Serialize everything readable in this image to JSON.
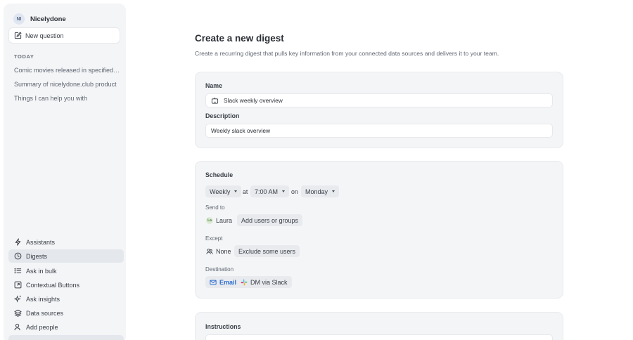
{
  "sidebar": {
    "workspace": {
      "avatar": "NI",
      "name": "Nicelydone"
    },
    "new_question": "New question",
    "section_today": "TODAY",
    "history": [
      "Comic movies released in specified d...",
      "Summary of nicelydone.club product",
      "Things I can help you with"
    ],
    "nav": [
      {
        "label": "Assistants",
        "icon": "bolt-icon"
      },
      {
        "label": "Digests",
        "icon": "clock-icon",
        "active": true
      },
      {
        "label": "Ask in bulk",
        "icon": "list-icon"
      },
      {
        "label": "Contextual Buttons",
        "icon": "external-link-icon"
      },
      {
        "label": "Ask insights",
        "icon": "sparkles-icon"
      },
      {
        "label": "Data sources",
        "icon": "layers-icon"
      },
      {
        "label": "Add people",
        "icon": "user-plus-icon"
      }
    ]
  },
  "main": {
    "title": "Create a new digest",
    "subtitle": "Create a recurring digest that pulls key information from your connected data sources and delivers it to your team.",
    "details": {
      "name_label": "Name",
      "name_value": "Slack weekly overview",
      "description_label": "Description",
      "description_value": "Weekly slack overview"
    },
    "schedule": {
      "label": "Schedule",
      "frequency": "Weekly",
      "at_word": "at",
      "time": "7:00 AM",
      "on_word": "on",
      "day": "Monday",
      "send_to_label": "Send to",
      "send_to_user": {
        "initials": "La",
        "name": "Laura"
      },
      "add_users": "Add users or groups",
      "except_label": "Except",
      "except_value": "None",
      "exclude_users": "Exclude some users",
      "destination_label": "Destination",
      "dest_email": "Email",
      "dest_slack": "DM via Slack"
    },
    "instructions": {
      "label": "Instructions"
    }
  },
  "colors": {
    "accent": "#2f6fd1",
    "sidebar_bg": "#f4f5f7",
    "card_bg": "#f4f5f7"
  }
}
